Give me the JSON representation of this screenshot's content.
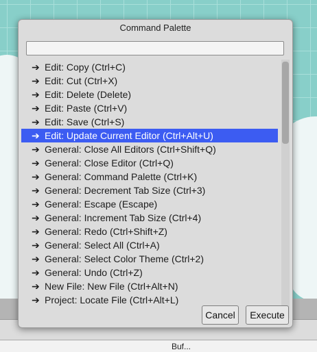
{
  "dialog": {
    "title": "Command Palette",
    "search": {
      "value": "",
      "placeholder": ""
    },
    "commands": [
      "Edit: Copy (Ctrl+C)",
      "Edit: Cut (Ctrl+X)",
      "Edit: Delete (Delete)",
      "Edit: Paste (Ctrl+V)",
      "Edit: Save (Ctrl+S)",
      "Edit: Update Current Editor (Ctrl+Alt+U)",
      "General: Close All Editors (Ctrl+Shift+Q)",
      "General: Close Editor (Ctrl+Q)",
      "General: Command Palette (Ctrl+K)",
      "General: Decrement Tab Size (Ctrl+3)",
      "General: Escape (Escape)",
      "General: Increment Tab Size (Ctrl+4)",
      "General: Redo (Ctrl+Shift+Z)",
      "General: Select All (Ctrl+A)",
      "General: Select Color Theme (Ctrl+2)",
      "General: Undo (Ctrl+Z)",
      "New File: New File (Ctrl+Alt+N)",
      "Project: Locate File (Ctrl+Alt+L)"
    ],
    "selected_index": 5,
    "arrow_icon": "arrow-right-icon",
    "buttons": {
      "cancel": "Cancel",
      "execute": "Execute"
    }
  },
  "background": {
    "status_text": "Buf..."
  },
  "colors": {
    "selection": "#3c5cf2",
    "dialog_bg": "#dcdcdc",
    "background": "#88cfc9"
  }
}
